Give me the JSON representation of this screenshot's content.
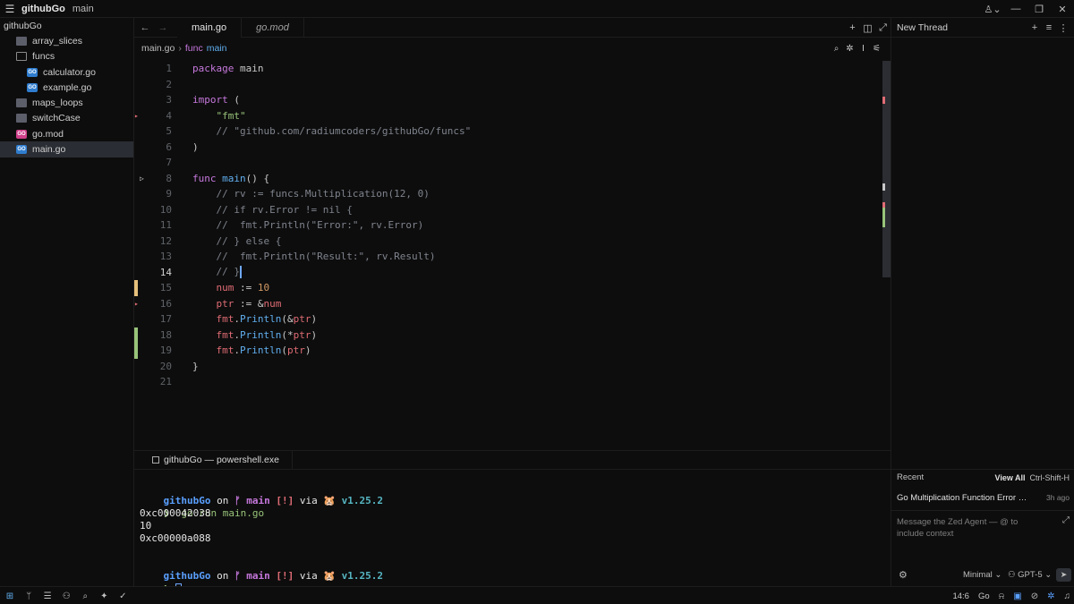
{
  "titlebar": {
    "menu_icon": "hamburger-menu-icon",
    "project": "githubGo",
    "branch": "main"
  },
  "sidebar": {
    "root": "githubGo",
    "items": [
      {
        "label": "array_slices",
        "kind": "folder",
        "depth": 1
      },
      {
        "label": "funcs",
        "kind": "folder-open",
        "depth": 1
      },
      {
        "label": "calculator.go",
        "kind": "go",
        "depth": 2
      },
      {
        "label": "example.go",
        "kind": "go",
        "depth": 2
      },
      {
        "label": "maps_loops",
        "kind": "folder",
        "depth": 1
      },
      {
        "label": "switchCase",
        "kind": "folder",
        "depth": 1
      },
      {
        "label": "go.mod",
        "kind": "mod",
        "depth": 1
      },
      {
        "label": "main.go",
        "kind": "go",
        "depth": 1,
        "selected": true
      }
    ]
  },
  "editor": {
    "tabs": [
      {
        "label": "main.go",
        "active": true
      },
      {
        "label": "go.mod",
        "active": false
      }
    ],
    "breadcrumb": {
      "file": "main.go",
      "keyword": "func",
      "symbol": "main"
    },
    "current_line": 14,
    "lines": [
      {
        "n": "1",
        "tokens": [
          [
            "kw",
            "package"
          ],
          [
            "plain",
            " main"
          ]
        ]
      },
      {
        "n": "2",
        "tokens": []
      },
      {
        "n": "3",
        "tokens": [
          [
            "kw",
            "import"
          ],
          [
            "plain",
            " ("
          ]
        ]
      },
      {
        "n": "4",
        "tokens": [
          [
            "plain",
            "    "
          ],
          [
            "str",
            "\"fmt\""
          ]
        ]
      },
      {
        "n": "5",
        "tokens": [
          [
            "plain",
            "    "
          ],
          [
            "cmt",
            "// \"github.com/radiumcoders/githubGo/funcs\""
          ]
        ]
      },
      {
        "n": "6",
        "tokens": [
          [
            "plain",
            ")"
          ]
        ]
      },
      {
        "n": "7",
        "tokens": []
      },
      {
        "n": "8",
        "tokens": [
          [
            "kw",
            "func"
          ],
          [
            "plain",
            " "
          ],
          [
            "fnc",
            "main"
          ],
          [
            "plain",
            "() {"
          ]
        ]
      },
      {
        "n": "9",
        "tokens": [
          [
            "plain",
            "    "
          ],
          [
            "cmt",
            "// rv := funcs.Multiplication(12, 0)"
          ]
        ]
      },
      {
        "n": "10",
        "tokens": [
          [
            "plain",
            "    "
          ],
          [
            "cmt",
            "// if rv.Error != nil {"
          ]
        ]
      },
      {
        "n": "11",
        "tokens": [
          [
            "plain",
            "    "
          ],
          [
            "cmt",
            "//  fmt.Println(\"Error:\", rv.Error)"
          ]
        ]
      },
      {
        "n": "12",
        "tokens": [
          [
            "plain",
            "    "
          ],
          [
            "cmt",
            "// } else {"
          ]
        ]
      },
      {
        "n": "13",
        "tokens": [
          [
            "plain",
            "    "
          ],
          [
            "cmt",
            "//  fmt.Println(\"Result:\", rv.Result)"
          ]
        ]
      },
      {
        "n": "14",
        "tokens": [
          [
            "plain",
            "    "
          ],
          [
            "cmt",
            "// }"
          ]
        ]
      },
      {
        "n": "15",
        "tokens": [
          [
            "plain",
            "    "
          ],
          [
            "var",
            "num"
          ],
          [
            "plain",
            " := "
          ],
          [
            "num",
            "10"
          ]
        ]
      },
      {
        "n": "16",
        "tokens": [
          [
            "plain",
            "    "
          ],
          [
            "var",
            "ptr"
          ],
          [
            "plain",
            " := &"
          ],
          [
            "var",
            "num"
          ]
        ]
      },
      {
        "n": "17",
        "tokens": [
          [
            "plain",
            "    "
          ],
          [
            "var",
            "fmt"
          ],
          [
            "plain",
            "."
          ],
          [
            "fnc",
            "Println"
          ],
          [
            "plain",
            "(&"
          ],
          [
            "var",
            "ptr"
          ],
          [
            "plain",
            ")"
          ]
        ]
      },
      {
        "n": "18",
        "tokens": [
          [
            "plain",
            "    "
          ],
          [
            "var",
            "fmt"
          ],
          [
            "plain",
            "."
          ],
          [
            "fnc",
            "Println"
          ],
          [
            "plain",
            "(*"
          ],
          [
            "var",
            "ptr"
          ],
          [
            "plain",
            ")"
          ]
        ]
      },
      {
        "n": "19",
        "tokens": [
          [
            "plain",
            "    "
          ],
          [
            "var",
            "fmt"
          ],
          [
            "plain",
            "."
          ],
          [
            "fnc",
            "Println"
          ],
          [
            "plain",
            "("
          ],
          [
            "var",
            "ptr"
          ],
          [
            "plain",
            ")"
          ]
        ]
      },
      {
        "n": "20",
        "tokens": [
          [
            "plain",
            "}"
          ]
        ]
      },
      {
        "n": "21",
        "tokens": []
      }
    ]
  },
  "terminal": {
    "tab_title": "githubGo — powershell.exe",
    "prompt1": {
      "dir": "githubGo",
      "on": " on ",
      "branch_icon": "ᚠ",
      "branch": " main",
      "status": " [!]",
      "via": " via ",
      "go_icon": "🐹",
      "version": " v1.25.2"
    },
    "command_prefix": "❯ ",
    "command": " go run main.go",
    "output": [
      "0xc000042038",
      "10",
      "0xc00000a088"
    ],
    "prompt2": {
      "dir": "githubGo",
      "on": " on ",
      "branch_icon": "ᚠ",
      "branch": " main",
      "status": " [!]",
      "via": " via ",
      "go_icon": "🐹",
      "version": " v1.25.2"
    },
    "prompt_arrow": "❯"
  },
  "agent": {
    "title": "New Thread",
    "recent_label": "Recent",
    "view_all": "View All",
    "view_all_shortcut": "Ctrl-Shift-H",
    "recent_item": "Go Multiplication Function Error …",
    "recent_time": "3h ago",
    "input_placeholder": "Message the Zed Agent — @ to include context",
    "mode": "Minimal ⌄",
    "model": "GPT-5 ⌄"
  },
  "status": {
    "cursor_pos": "14:6",
    "language": "Go"
  },
  "colors": {
    "keyword": "#c678dd",
    "function": "#61afef",
    "string": "#98c379",
    "comment": "#7f848e",
    "number": "#d19a66",
    "variable": "#e06c75",
    "accent": "#5aa0ff",
    "git_modified": "#e5c07b",
    "git_added": "#98c379"
  }
}
